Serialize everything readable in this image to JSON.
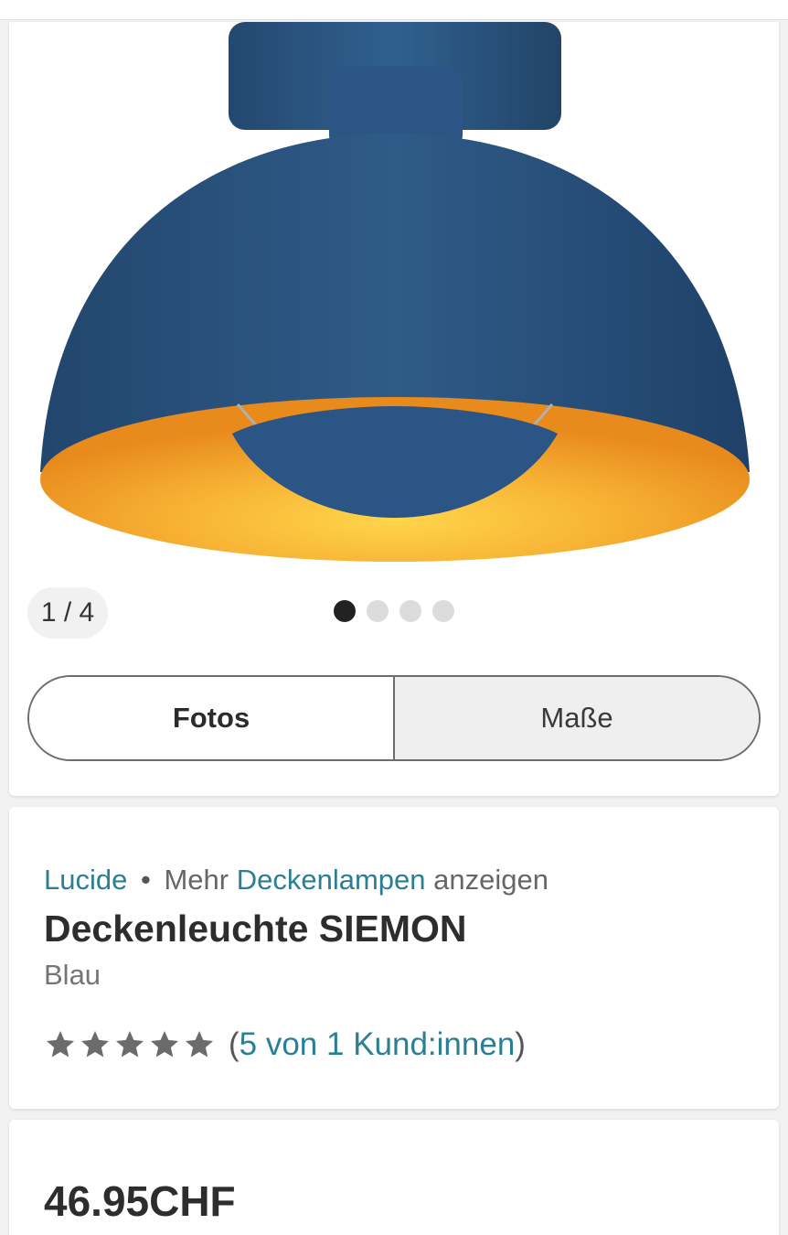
{
  "gallery": {
    "counter": "1 / 4",
    "slide_count": 4,
    "active_index": 0,
    "image_icon": "ceiling-lamp-image",
    "tabs": {
      "photos": "Fotos",
      "dimensions": "Maße"
    },
    "colors": {
      "lamp_blue": "#2d5a86",
      "lamp_inner": "#f5a623"
    }
  },
  "product": {
    "brand": "Lucide",
    "breadcrumb_prefix": "Mehr",
    "category": "Deckenlampen",
    "breadcrumb_suffix": "anzeigen",
    "title": "Deckenleuchte SIEMON",
    "color": "Blau",
    "rating": {
      "stars": 5,
      "open_paren": "(",
      "text": "5 von 1 Kund:innen",
      "close_paren": ")"
    },
    "price": "46.95CHF"
  },
  "theme": {
    "link_color": "#2b7f95",
    "star_color": "#6b6b6b"
  }
}
